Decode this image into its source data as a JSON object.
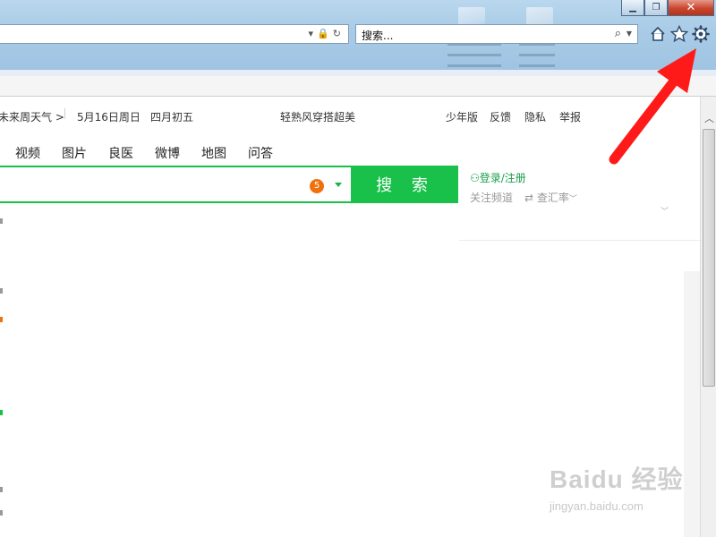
{
  "window": {
    "controls": {
      "minimize": "▁",
      "restore": "❐",
      "close": "✕"
    }
  },
  "addressbar": {
    "value": ""
  },
  "searchbox": {
    "value": "搜索..."
  },
  "icons": {
    "home": "home-icon",
    "favorites": "star-icon",
    "tools": "gear-icon"
  },
  "page": {
    "topbar": {
      "weather": "未来周天气 >",
      "date": "5月16日周日",
      "lunar": "四月初五",
      "promo": "轻熟风穿搭超美",
      "links": [
        "少年版",
        "反馈",
        "隐私",
        "举报"
      ]
    },
    "tabs": [
      "视频",
      "图片",
      "良医",
      "微博",
      "地图",
      "问答"
    ],
    "search": {
      "badge": "5",
      "button": "搜 索"
    },
    "user": {
      "login": "登录/注册",
      "follow": "关注频道",
      "rate": "查汇率"
    }
  },
  "annotation": {
    "arrow_color": "#ff1a1a"
  },
  "watermark": {
    "brand": "Baidu 经验",
    "url": "jingyan.baidu.com"
  },
  "colors": {
    "brand_green": "#19c04a",
    "badge_orange": "#f0700e"
  }
}
